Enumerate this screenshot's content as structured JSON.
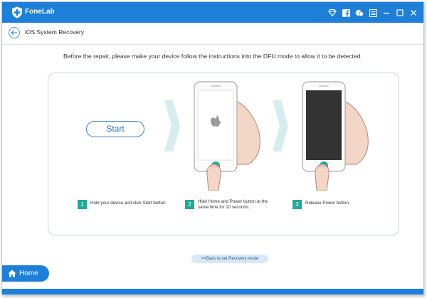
{
  "titlebar": {
    "app_name": "FoneLab",
    "icons": [
      "diamond-icon",
      "facebook-icon",
      "chat-icon",
      "menu-icon",
      "minimize-icon",
      "maximize-icon",
      "close-icon"
    ]
  },
  "subheader": {
    "title": "iOS System Recovery"
  },
  "instruction": "Before the repair, please make your device follow the instructions into the DFU mode to allow it to be detected.",
  "start_label": "Start",
  "steps": [
    {
      "num": "1",
      "text": "Hold your device and click Start button."
    },
    {
      "num": "2",
      "text": "Hold Home and Power button at the same time for 10 seconds."
    },
    {
      "num": "3",
      "text": "Release Power button."
    }
  ],
  "recovery_link": "<<Back to set Recovery mode",
  "home_label": "Home",
  "colors": {
    "brand": "#1e7fd9",
    "accent": "#22a89c",
    "chevron": "#d6ecef"
  }
}
